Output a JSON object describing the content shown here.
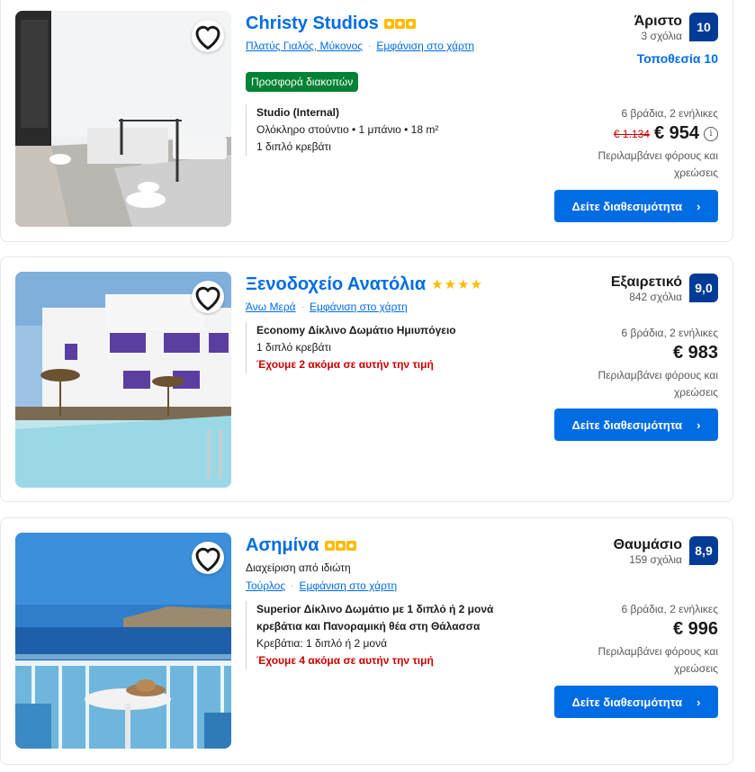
{
  "colors": {
    "brand_blue": "#006ce4",
    "score_blue": "#003b95",
    "deal_green": "#008234",
    "warning_red": "#cc0000",
    "star_yellow": "#febb02"
  },
  "listings": [
    {
      "name": "Christy Studios",
      "rating_icon": "yellow-squares",
      "rating_count": 3,
      "location": "Πλατύς Γιαλός, Μύκονος",
      "map_link": "Εμφάνιση στο χάρτη",
      "deal_badge": "Προσφορά διακοπών",
      "room_name": "Studio (Internal)",
      "room_line1": "Ολόκληρο στούντιο • 1 μπάνιο • 18 m²",
      "room_line2": "1 διπλό κρεβάτι",
      "review_word": "Άριστο",
      "review_count": "3 σχόλια",
      "score": "10",
      "location_score": "Τοποθεσία 10",
      "stay": "6 βράδια, 2 ενήλικες",
      "old_price": "€ 1.134",
      "price": "€ 954",
      "taxes_line1": "Περιλαμβάνει φόρους και",
      "taxes_line2": "χρεώσεις",
      "button": "Δείτε διαθεσιμότητα"
    },
    {
      "name": "Ξενοδοχείο Ανατόλια",
      "rating_icon": "star",
      "rating_count": 4,
      "location": "Άνω Μερά",
      "map_link": "Εμφάνιση στο χάρτη",
      "room_name": "Economy Δίκλινο Δωμάτιο Ημιυπόγειο",
      "room_line1": "1 διπλό κρεβάτι",
      "room_warning": "Έχουμε 2 ακόμα σε αυτήν την τιμή",
      "review_word": "Εξαιρετικό",
      "review_count": "842 σχόλια",
      "score": "9,0",
      "stay": "6 βράδια, 2 ενήλικες",
      "price": "€ 983",
      "taxes_line1": "Περιλαμβάνει φόρους και",
      "taxes_line2": "χρεώσεις",
      "button": "Δείτε διαθεσιμότητα"
    },
    {
      "name": "Ασημίνα",
      "rating_icon": "yellow-squares",
      "rating_count": 3,
      "managed_by": "Διαχείριση από ιδιώτη",
      "location": "Τούρλος",
      "map_link": "Εμφάνιση στο χάρτη",
      "room_name_line1": "Superior Δίκλινο Δωμάτιο με 1 διπλό ή 2 μονά",
      "room_name_line2": "κρεβάτια και Πανοραμική θέα στη Θάλασσα",
      "room_line1": "Κρεβάτια: 1 διπλό ή 2 μονά",
      "room_warning": "Έχουμε 4 ακόμα σε αυτήν την τιμή",
      "review_word": "Θαυμάσιο",
      "review_count": "159 σχόλια",
      "score": "8,9",
      "stay": "6 βράδια, 2 ενήλικες",
      "price": "€ 996",
      "taxes_line1": "Περιλαμβάνει φόρους και",
      "taxes_line2": "χρεώσεις",
      "button": "Δείτε διαθεσιμότητα"
    }
  ]
}
